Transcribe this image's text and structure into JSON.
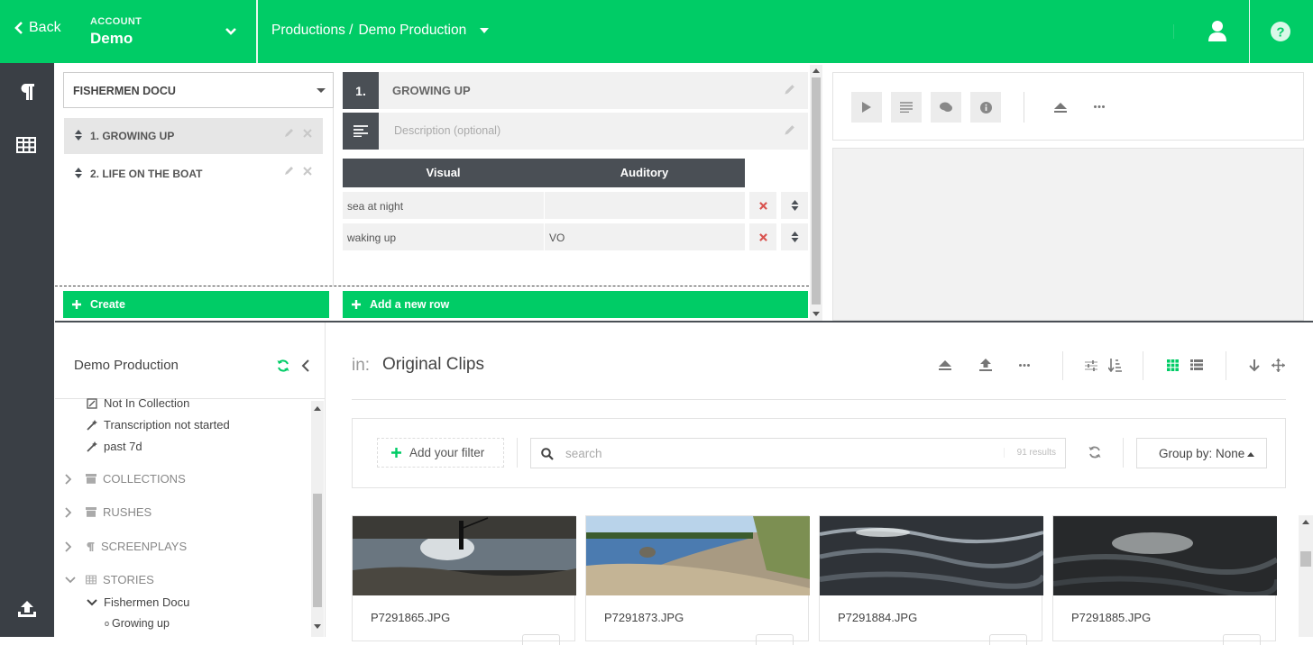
{
  "header": {
    "back_label": "Back",
    "account_label": "ACCOUNT",
    "account_name": "Demo",
    "breadcrumb_root": "Productions /",
    "breadcrumb_current": "Demo Production"
  },
  "story": {
    "selected": "FISHERMEN DOCU",
    "scenes": [
      "1. GROWING UP",
      "2. LIFE ON THE BOAT"
    ],
    "create_label": "Create"
  },
  "script": {
    "scene_number": "1.",
    "scene_title": "GROWING UP",
    "description_placeholder": "Description (optional)",
    "columns": [
      "Visual",
      "Auditory"
    ],
    "rows": [
      {
        "visual": "sea at night",
        "auditory": ""
      },
      {
        "visual": "waking up",
        "auditory": "VO"
      }
    ],
    "add_row_label": "Add a new row"
  },
  "browser": {
    "title": "Demo Production",
    "tree": {
      "smart_items": [
        "Not In Collection",
        "Transcription not started",
        "past 7d"
      ],
      "sections": [
        "COLLECTIONS",
        "RUSHES",
        "SCREENPLAYS",
        "STORIES"
      ],
      "story_name": "Fishermen Docu",
      "scene_name": "Growing up"
    }
  },
  "clips": {
    "in_label": "in:",
    "location": "Original Clips",
    "add_filter_label": "Add your filter",
    "search_placeholder": "search",
    "result_count": "91 results",
    "group_by_label": "Group by: None",
    "items": [
      {
        "name": "P7291865.JPG"
      },
      {
        "name": "P7291873.JPG"
      },
      {
        "name": "P7291884.JPG"
      },
      {
        "name": "P7291885.JPG"
      }
    ]
  },
  "colors": {
    "brand_green": "#00cc66",
    "dark_rail": "#3a3f45",
    "delete_red": "#d9534f"
  }
}
